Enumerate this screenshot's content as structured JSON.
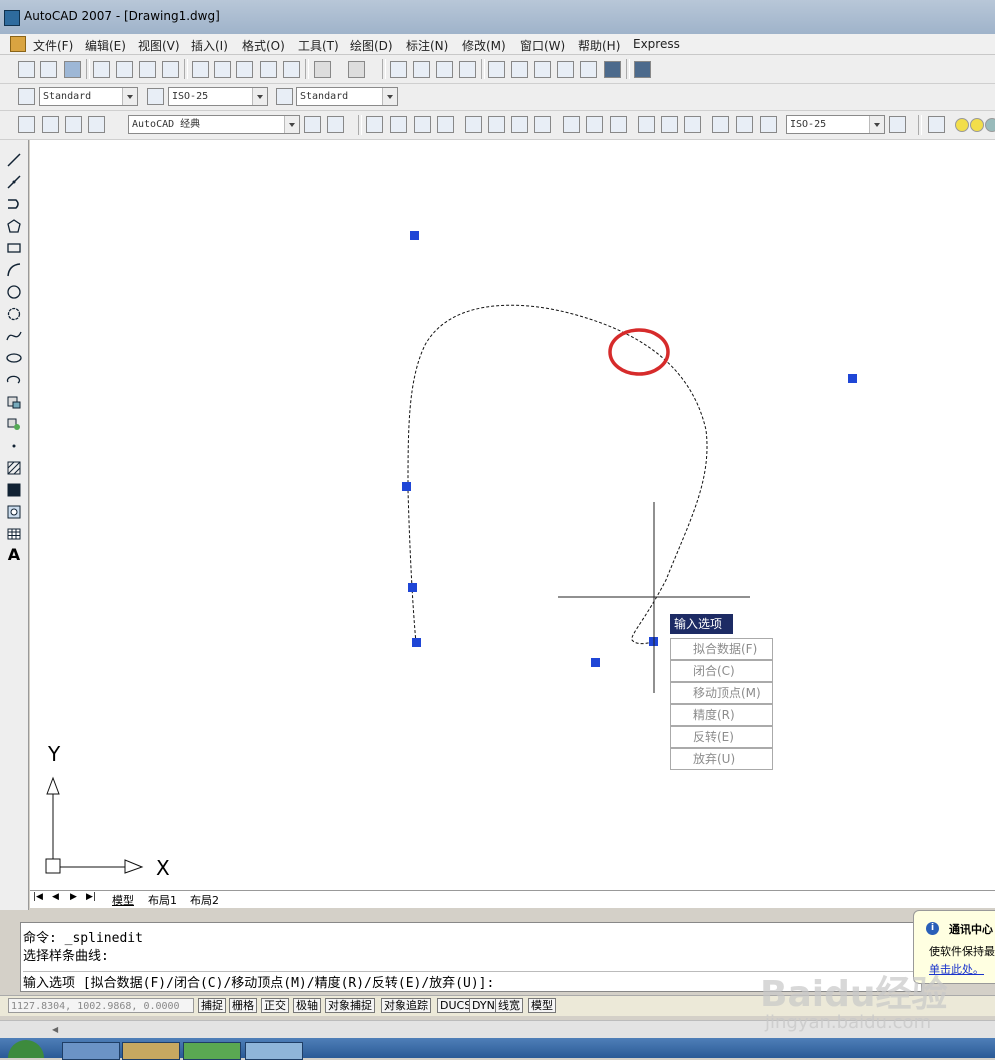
{
  "window": {
    "title": "AutoCAD 2007 - [Drawing1.dwg]"
  },
  "menu": {
    "items": [
      "文件(F)",
      "编辑(E)",
      "视图(V)",
      "插入(I)",
      "格式(O)",
      "工具(T)",
      "绘图(D)",
      "标注(N)",
      "修改(M)",
      "窗口(W)",
      "帮助(H)",
      "Express"
    ]
  },
  "styles_toolbar": {
    "text_style": "Standard",
    "dim_style": "ISO-25",
    "table_style": "Standard"
  },
  "workspace_toolbar": {
    "workspace": "AutoCAD 经典",
    "dim_style2": "ISO-25"
  },
  "layout_tabs": [
    "模型",
    "布局1",
    "布局2"
  ],
  "ucs": {
    "y_label": "Y",
    "x_label": "X"
  },
  "context_menu": {
    "header": "输入选项",
    "items": [
      "拟合数据(F)",
      "闭合(C)",
      "移动顶点(M)",
      "精度(R)",
      "反转(E)",
      "放弃(U)"
    ]
  },
  "command_line": {
    "line1": "命令: _splinedit",
    "line2": "选择样条曲线:",
    "line3": "输入选项 [拟合数据(F)/闭合(C)/移动顶点(M)/精度(R)/反转(E)/放弃(U)]:"
  },
  "status_bar": {
    "coordinates": "1127.8304, 1002.9868, 0.0000",
    "toggles": [
      "捕捉",
      "栅格",
      "正交",
      "极轴",
      "对象捕捉",
      "对象追踪",
      "DUCS",
      "DYN",
      "线宽",
      "模型"
    ]
  },
  "notification": {
    "title": "通讯中心",
    "body": "使软件保持最",
    "link": "单击此处。"
  },
  "watermark": {
    "logo": "Baidu经验",
    "url": "jingyan.baidu.com"
  },
  "colors": {
    "highlight_circle": "#d62b2b",
    "grip": "#1f46d6",
    "menu_header": "#1d2b64"
  }
}
